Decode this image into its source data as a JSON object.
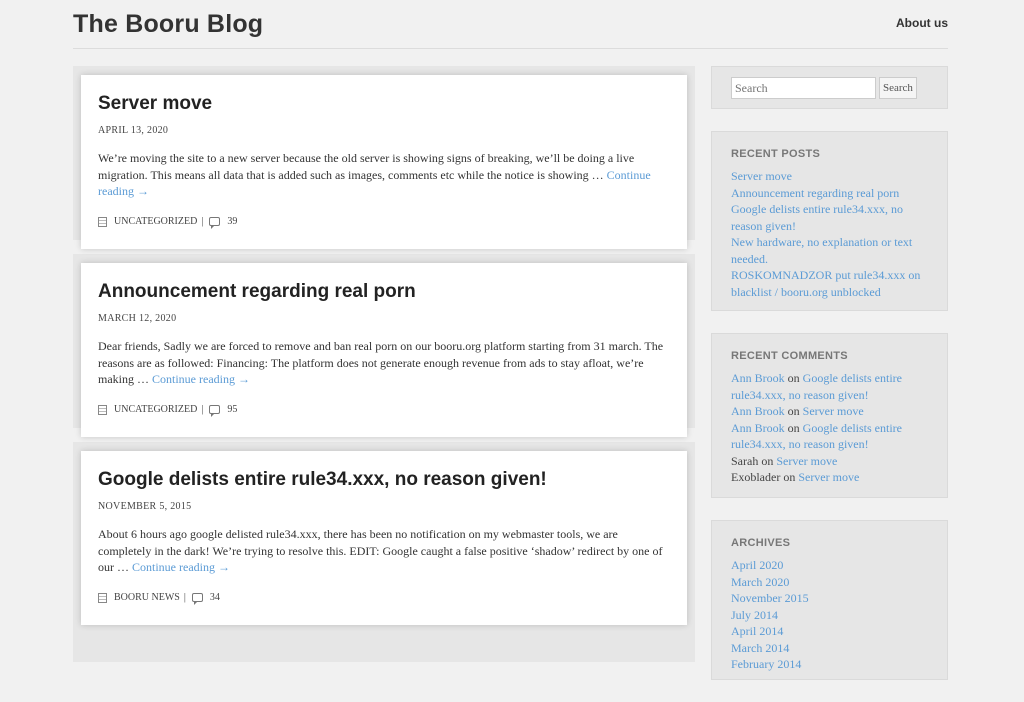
{
  "site": {
    "title": "The Booru Blog",
    "nav_about": "About us"
  },
  "posts": [
    {
      "title": "Server move",
      "date": "April 13, 2020",
      "excerpt": "We’re moving the site to a new server because the old server is showing signs of breaking, we’ll be doing a live migration. This means all data that is added such as images, comments etc while the notice is showing … ",
      "more": "Continue reading →",
      "category": "Uncategorized",
      "sep": "|",
      "comments": "39"
    },
    {
      "title": "Announcement regarding real porn",
      "date": "March 12, 2020",
      "excerpt": "Dear friends, Sadly we are forced to remove and ban real porn on our booru.org platform starting from 31 march. The reasons are as followed: Financing: The platform does not generate enough revenue from ads to stay afloat, we’re making … ",
      "more": "Continue reading →",
      "category": "Uncategorized",
      "sep": "|",
      "comments": "95"
    },
    {
      "title": "Google delists entire rule34.xxx, no reason given!",
      "date": "November 5, 2015",
      "excerpt": "About 6 hours ago google delisted rule34.xxx, there has been no notification on my webmaster tools, we are completely in the dark! We’re trying to resolve this.   EDIT: Google caught a false positive ‘shadow’ redirect by one of our … ",
      "more": "Continue reading →",
      "category": "Booru News",
      "sep": "|",
      "comments": "34"
    }
  ],
  "sidebar": {
    "search": {
      "placeholder": "Search",
      "button": "Search"
    },
    "recent_posts": {
      "title": "Recent Posts",
      "items": [
        "Server move",
        "Announcement regarding real porn",
        "Google delists entire rule34.xxx, no reason given!",
        "New hardware, no explanation or text needed.",
        "ROSKOMNADZOR put rule34.xxx on blacklist / booru.org unblocked"
      ]
    },
    "recent_comments": {
      "title": "Recent Comments",
      "on": "on",
      "items": [
        {
          "author": "Ann Brook",
          "author_link": true,
          "post": "Google delists entire rule34.xxx, no reason given!"
        },
        {
          "author": "Ann Brook",
          "author_link": true,
          "post": "Server move"
        },
        {
          "author": "Ann Brook",
          "author_link": true,
          "post": "Google delists entire rule34.xxx, no reason given!"
        },
        {
          "author": "Sarah",
          "author_link": false,
          "post": "Server move"
        },
        {
          "author": "Exoblader",
          "author_link": false,
          "post": "Server move"
        }
      ]
    },
    "archives": {
      "title": "Archives",
      "items": [
        "April 2020",
        "March 2020",
        "November 2015",
        "July 2014",
        "April 2014",
        "March 2014",
        "February 2014"
      ]
    }
  },
  "colors": {
    "link": "#5b9bd5",
    "background": "#f1f1f1",
    "card": "#ffffff"
  },
  "icons": {
    "category": "document-icon",
    "comments": "speech-bubble-icon"
  }
}
